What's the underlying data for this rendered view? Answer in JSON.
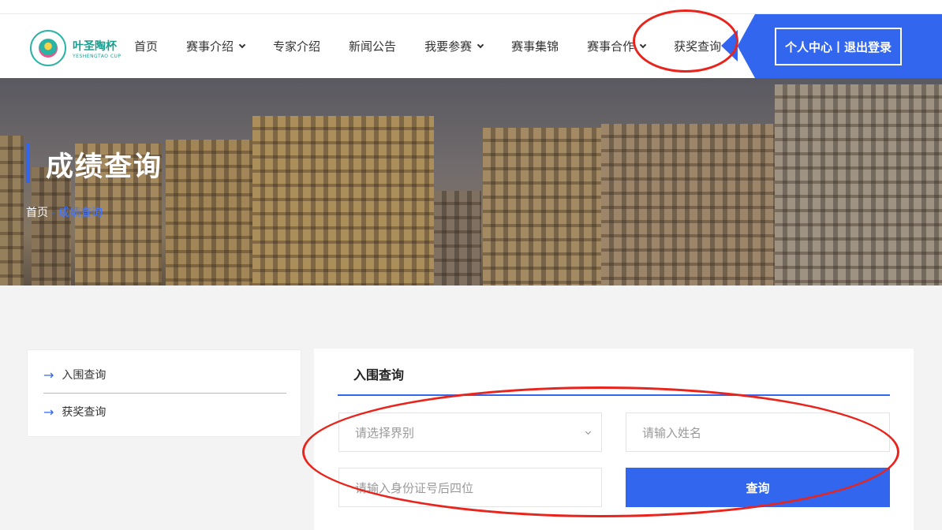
{
  "header": {
    "logo_cn": "叶圣陶杯",
    "logo_en": "YESHENGTAO CUP",
    "nav": [
      {
        "label": "首页",
        "has_dropdown": false
      },
      {
        "label": "赛事介绍",
        "has_dropdown": true
      },
      {
        "label": "专家介绍",
        "has_dropdown": false
      },
      {
        "label": "新闻公告",
        "has_dropdown": false
      },
      {
        "label": "我要参赛",
        "has_dropdown": true
      },
      {
        "label": "赛事集锦",
        "has_dropdown": false
      },
      {
        "label": "赛事合作",
        "has_dropdown": true
      },
      {
        "label": "获奖查询",
        "has_dropdown": false
      }
    ],
    "user_button": "个人中心丨退出登录"
  },
  "banner": {
    "title": "成绩查询",
    "breadcrumb_home": "首页",
    "breadcrumb_sep": "-",
    "breadcrumb_current": "成绩查询"
  },
  "sidebar": {
    "items": [
      {
        "label": "入围查询"
      },
      {
        "label": "获奖查询"
      }
    ]
  },
  "query_panel": {
    "tab_label": "入围查询",
    "session_placeholder": "请选择界别",
    "name_placeholder": "请输入姓名",
    "id_placeholder": "请输入身份证号后四位",
    "submit_label": "查询"
  },
  "colors": {
    "accent": "#3366ee",
    "annotation": "#e8241c",
    "logo": "#1a9f8f"
  }
}
